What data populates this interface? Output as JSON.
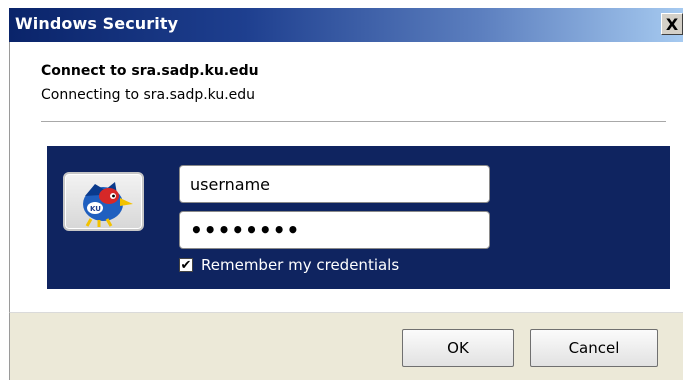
{
  "window": {
    "title": "Windows Security",
    "close_glyph": "X"
  },
  "prompt": {
    "heading": "Connect to sra.sadp.ku.edu",
    "subheading": "Connecting to sra.sadp.ku.edu"
  },
  "credentials": {
    "avatar_icon": "jayhawk-logo-icon",
    "username_value": "username",
    "password_masked": "••••••••",
    "remember_label": "Remember my credentials",
    "remember_checked": true
  },
  "buttons": {
    "ok_label": "OK",
    "cancel_label": "Cancel"
  },
  "colors": {
    "title_bar_start": "#0a246a",
    "panel_bg": "#0f2460",
    "footer_bg": "#ece9d8"
  }
}
